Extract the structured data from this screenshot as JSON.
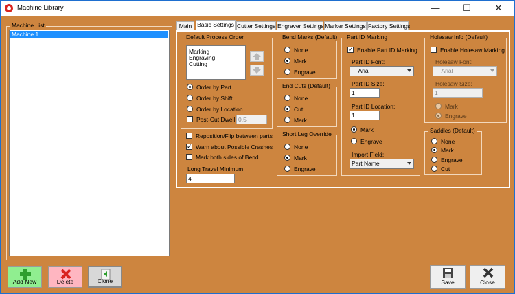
{
  "window": {
    "title": "Machine Library",
    "minimize": "—",
    "maximize": "☐",
    "close": "✕"
  },
  "machine_list": {
    "title": "Machine List",
    "items": [
      "Machine 1"
    ]
  },
  "tabs": [
    "Main",
    "Basic Settings",
    "Cutter Settings",
    "Engraver Settings",
    "Marker Settings",
    "Factory Settings"
  ],
  "process_order": {
    "title": "Default Process Order",
    "items": [
      "Marking",
      "Engraving",
      "Cutting"
    ],
    "order_by_part": "Order by Part",
    "order_by_shift": "Order by Shift",
    "order_by_location": "Order by Location",
    "post_cut_dwell": "Post-Cut Dwell:",
    "post_cut_dwell_value": "0.5"
  },
  "options": {
    "reposition": "Reposition/Flip between parts",
    "warn_crashes": "Warn about Possible Crashes",
    "mark_both": "Mark both sides of Bend",
    "long_travel_label": "Long Travel Minimum:",
    "long_travel_value": "4"
  },
  "bend_marks": {
    "title": "Bend Marks (Default)",
    "none": "None",
    "mark": "Mark",
    "engrave": "Engrave"
  },
  "end_cuts": {
    "title": "End Cuts (Default)",
    "none": "None",
    "cut": "Cut",
    "mark": "Mark"
  },
  "short_leg": {
    "title": "Short Leg Override",
    "none": "None",
    "mark": "Mark",
    "engrave": "Engrave"
  },
  "part_id": {
    "title": "Part ID Marking",
    "enable": "Enable Part ID Marking",
    "font_label": "Part ID Font:",
    "font_value": "__Arial",
    "size_label": "Part ID Size:",
    "size_value": "1",
    "location_label": "Part ID Location:",
    "location_value": "1",
    "mark": "Mark",
    "engrave": "Engrave",
    "import_label": "Import Field:",
    "import_value": "Part Name"
  },
  "holesaw": {
    "title": "Holesaw Info (Default)",
    "enable": "Enable Holesaw Marking",
    "font_label": "Holesaw Font:",
    "font_value": "__Arial",
    "size_label": "Holesaw Size:",
    "size_value": "1",
    "mark": "Mark",
    "engrave": "Engrave"
  },
  "saddles": {
    "title": "Saddles (Default)",
    "none": "None",
    "mark": "Mark",
    "engrave": "Engrave",
    "cut": "Cut"
  },
  "buttons": {
    "add_new": "Add New",
    "delete": "Delete",
    "clone": "Clone",
    "save": "Save",
    "close": "Close"
  },
  "colors": {
    "background": "#CD853F",
    "selection": "#1E90FF",
    "add": "#90EE90",
    "delete": "#FFB6C1"
  }
}
